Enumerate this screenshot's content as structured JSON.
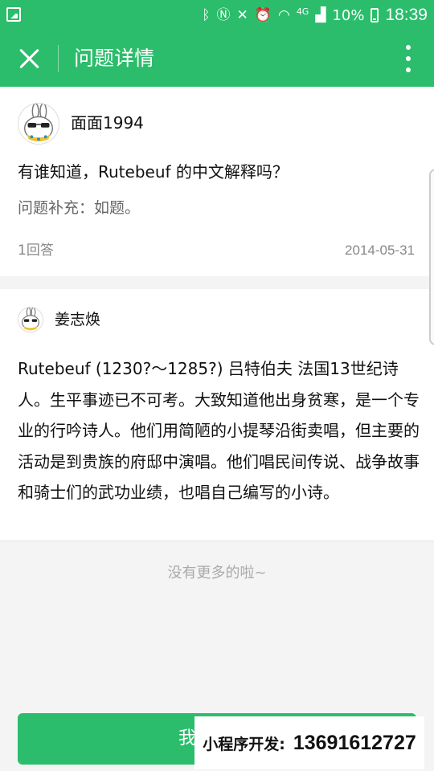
{
  "status_bar": {
    "signal_type": "4G",
    "battery": "10%",
    "time": "18:39",
    "icons": [
      "gallery-icon",
      "bluetooth-icon",
      "nfc-icon",
      "mute-icon",
      "alarm-icon",
      "wifi-icon",
      "signal-icon",
      "battery-icon"
    ]
  },
  "header": {
    "title": "问题详情",
    "close_icon": "close-icon",
    "more_icon": "more-vertical-icon"
  },
  "question": {
    "asker": "面面1994",
    "title": "有谁知道，Rutebeuf 的中文解释吗？",
    "supplement": "问题补充：如题。",
    "answer_count": "1回答",
    "date": "2014-05-31"
  },
  "answer": {
    "author": "姜志焕",
    "content": "Rutebeuf (1230?～1285?) 吕特伯夫 法国13世纪诗人。生平事迹已不可考。大致知道他出身贫寒，是一个专业的行吟诗人。他们用简陋的小提琴沿街卖唱，但主要的活动是到贵族的府邸中演唱。他们唱民间传说、战争故事和骑士们的武功业绩，也唱自己编写的小诗。"
  },
  "footer": {
    "no_more": "没有更多的啦~",
    "answer_button_label": "我",
    "promo_label": "小程序开发:",
    "promo_phone": "13691612727"
  },
  "colors": {
    "accent": "#2bbd6b",
    "background": "#f4f4f4",
    "secondary_text": "#888888"
  }
}
